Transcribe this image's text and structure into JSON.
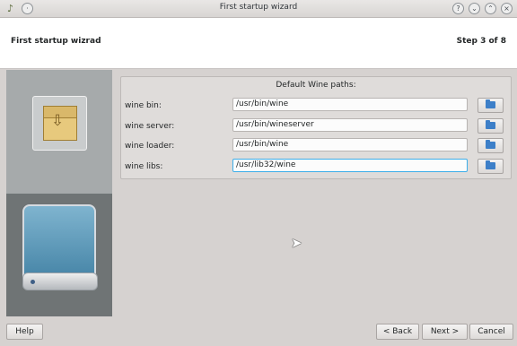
{
  "window": {
    "title": "First startup wizard",
    "controls": [
      "help-icon",
      "minimize-icon",
      "maximize-icon",
      "close-icon"
    ]
  },
  "header": {
    "title": "First startup wizrad",
    "step": "Step 3 of 8"
  },
  "panel": {
    "heading": "Default Wine paths:",
    "rows": [
      {
        "label": "wine bin:",
        "value": "/usr/bin/wine",
        "icon": "folder-icon"
      },
      {
        "label": "wine server:",
        "value": "/usr/bin/wineserver",
        "icon": "folder-icon"
      },
      {
        "label": "wine loader:",
        "value": "/usr/bin/wine",
        "icon": "folder-icon"
      },
      {
        "label": "wine libs:",
        "value": "/usr/lib32/wine",
        "icon": "folder-icon"
      }
    ]
  },
  "footer": {
    "help": "Help",
    "back": "< Back",
    "next": "Next >",
    "cancel": "Cancel"
  },
  "colors": {
    "focus": "#3daee9",
    "folder": "#3d7fc8",
    "window_bg": "#d6d2d0"
  }
}
